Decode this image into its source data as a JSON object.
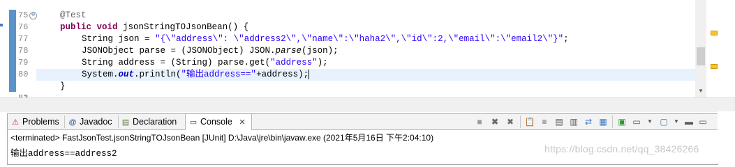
{
  "editor": {
    "lines": [
      {
        "no": "75"
      },
      {
        "no": "76",
        "annotation": "@Test"
      },
      {
        "no": "77",
        "kw1": "public",
        "kw2": "void",
        "text": " jsonStringTOJsonBean() {"
      },
      {
        "no": "78",
        "type": "String",
        "var": "json",
        "eq": " = ",
        "str": "\"{\\\"address\\\": \\\"address2\\\",\\\"name\\\":\\\"haha2\\\",\\\"id\\\":2,\\\"email\\\":\\\"email2\\\"}\"",
        "tail": ";"
      },
      {
        "no": "79",
        "text1": "JSONObject parse = (JSONObject) JSON.",
        "method": "parse",
        "text2": "(json);"
      },
      {
        "no": "80",
        "type": "String",
        "var": "address",
        "text1": " = (String) parse.get(",
        "str": "\"address\"",
        "tail": ");"
      },
      {
        "no": "81",
        "text1": "System.",
        "field": "out",
        "text2": ".println(",
        "str": "\"输出address==\"",
        "tail": "+address);"
      },
      {
        "no": "82",
        "text": "}"
      }
    ],
    "fold_icon": "⊖"
  },
  "tabs": [
    {
      "label": "Problems",
      "icon": "problems-icon"
    },
    {
      "label": "Javadoc",
      "icon": "javadoc-icon"
    },
    {
      "label": "Declaration",
      "icon": "declaration-icon"
    },
    {
      "label": "Console",
      "icon": "console-icon",
      "active": true
    }
  ],
  "close_glyph": "✕",
  "console": {
    "header": "<terminated> FastJsonTest.jsonStringTOJsonBean [JUnit] D:\\Java\\jre\\bin\\javaw.exe (2021年5月16日 下午2:04:10)",
    "output": "输出address==address2"
  },
  "watermark": "https://blog.csdn.net/qq_38426266",
  "colors": {
    "keyword": "#7f0055",
    "string": "#2a00ff",
    "field": "#0000c0",
    "annotation": "#646464",
    "current_line": "#e8f2fe"
  }
}
